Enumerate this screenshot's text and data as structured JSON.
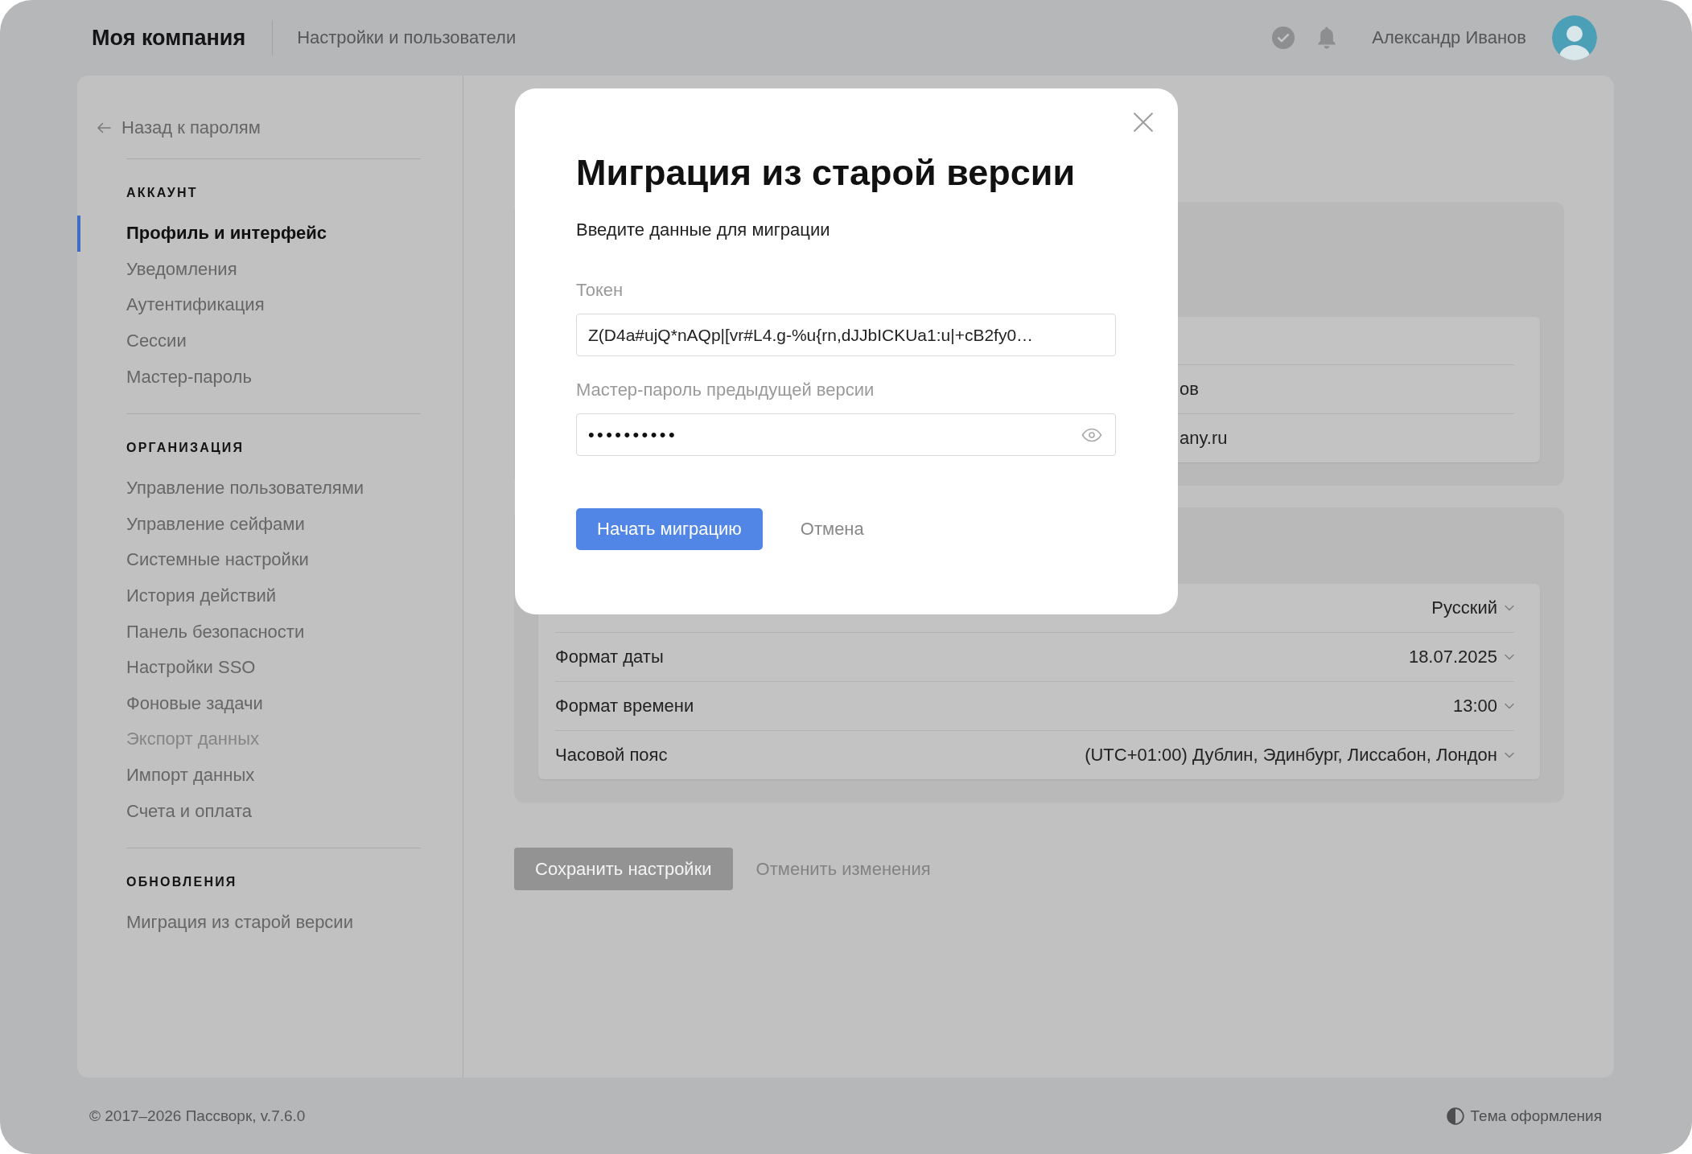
{
  "header": {
    "logo": "Моя компания",
    "section": "Настройки и пользователи",
    "user_name": "Александр Иванов"
  },
  "sidebar": {
    "back_link": "Назад к паролям",
    "groups": [
      {
        "title": "АККАУНТ",
        "items": [
          {
            "label": "Профиль и интерфейс",
            "selected": true,
            "disabled": false
          },
          {
            "label": "Уведомления",
            "selected": false,
            "disabled": false
          },
          {
            "label": "Аутентификация",
            "selected": false,
            "disabled": false
          },
          {
            "label": "Сессии",
            "selected": false,
            "disabled": false
          },
          {
            "label": "Мастер-пароль",
            "selected": false,
            "disabled": false
          }
        ]
      },
      {
        "title": "ОРГАНИЗАЦИЯ",
        "items": [
          {
            "label": "Управление пользователями",
            "selected": false,
            "disabled": false
          },
          {
            "label": "Управление сейфами",
            "selected": false,
            "disabled": false
          },
          {
            "label": "Системные настройки",
            "selected": false,
            "disabled": false
          },
          {
            "label": "История действий",
            "selected": false,
            "disabled": false
          },
          {
            "label": "Панель безопасности",
            "selected": false,
            "disabled": false
          },
          {
            "label": "Настройки SSO",
            "selected": false,
            "disabled": false
          },
          {
            "label": "Фоновые задачи",
            "selected": false,
            "disabled": false
          },
          {
            "label": "Экспорт данных",
            "selected": false,
            "disabled": true
          },
          {
            "label": "Импорт данных",
            "selected": false,
            "disabled": false
          },
          {
            "label": "Счета и оплата",
            "selected": false,
            "disabled": false
          }
        ]
      },
      {
        "title": "ОБНОВЛЕНИЯ",
        "items": [
          {
            "label": "Миграция из старой версии",
            "selected": false,
            "disabled": false
          }
        ]
      }
    ]
  },
  "content": {
    "profile_rows": [
      {
        "value": "ов"
      },
      {
        "value": "any.ru"
      }
    ],
    "settings_rows": [
      {
        "value": "Русский"
      },
      {
        "label": "Формат даты",
        "value": "18.07.2025"
      },
      {
        "label": "Формат времени",
        "value": "13:00"
      },
      {
        "label": "Часовой пояс",
        "value": "(UTC+01:00) Дублин, Эдинбург, Лиссабон, Лондон"
      }
    ],
    "save_button": {
      "label": "Сохранить настройки",
      "disabled": true
    },
    "cancel_button": {
      "label": "Отменить изменения",
      "disabled": true
    }
  },
  "modal": {
    "title": "Миграция из старой версии",
    "subtitle": "Введите данные для миграции",
    "fields": [
      {
        "kind": "text",
        "label": "Токен",
        "value": "Z(D4a#ujQ*nAQp|[vr#L4.g-%u{rn,dJJbICKUa1:u|+cB2fy0…"
      },
      {
        "kind": "password",
        "label": "Мастер-пароль предыдущей версии",
        "value": "••••••••••"
      }
    ],
    "primary_button": "Начать миграцию",
    "cancel_button": "Отмена"
  },
  "footer": {
    "copyright": "© 2017–2026 Пассворк, v.7.6.0",
    "theme_button": "Тема оформления"
  }
}
